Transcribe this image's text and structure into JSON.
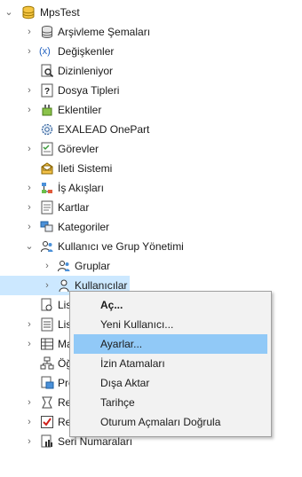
{
  "tree": {
    "items": [
      {
        "label": "MpsTest",
        "expander": "expanded",
        "icon": "database-icon"
      },
      {
        "label": "Arşivleme Şemaları",
        "expander": "collapsed",
        "icon": "archive-schema-icon"
      },
      {
        "label": "Değişkenler",
        "expander": "collapsed",
        "icon": "variable-icon",
        "icon_text": "(x)"
      },
      {
        "label": "Dizinleniyor",
        "expander": "none",
        "icon": "index-search-icon"
      },
      {
        "label": "Dosya Tipleri",
        "expander": "collapsed",
        "icon": "file-type-icon"
      },
      {
        "label": "Eklentiler",
        "expander": "collapsed",
        "icon": "plugin-icon"
      },
      {
        "label": "EXALEAD OnePart",
        "expander": "none",
        "icon": "gear-icon"
      },
      {
        "label": "Görevler",
        "expander": "collapsed",
        "icon": "task-list-icon"
      },
      {
        "label": "İleti Sistemi",
        "expander": "none",
        "icon": "mail-icon"
      },
      {
        "label": "İş Akışları",
        "expander": "collapsed",
        "icon": "workflow-icon"
      },
      {
        "label": "Kartlar",
        "expander": "collapsed",
        "icon": "card-icon"
      },
      {
        "label": "Kategoriler",
        "expander": "collapsed",
        "icon": "category-icon"
      },
      {
        "label": "Kullanıcı ve Grup Yönetimi",
        "expander": "expanded",
        "icon": "user-group-icon"
      },
      {
        "label": "Gruplar",
        "expander": "collapsed",
        "icon": "group-icon"
      },
      {
        "label": "Kullanıcılar",
        "expander": "collapsed",
        "icon": "user-icon"
      },
      {
        "label": "Lis",
        "expander": "none",
        "icon": "list-doc-icon"
      },
      {
        "label": "Lis",
        "expander": "collapsed",
        "icon": "list-icon"
      },
      {
        "label": "Ma",
        "expander": "collapsed",
        "icon": "table-icon"
      },
      {
        "label": "Öğ",
        "expander": "none",
        "icon": "tree-items-icon"
      },
      {
        "label": "Pro",
        "expander": "none",
        "icon": "doc-blue-icon"
      },
      {
        "label": "Re",
        "expander": "collapsed",
        "icon": "revision-icon"
      },
      {
        "label": "Re",
        "expander": "collapsed",
        "icon": "red-check-icon"
      },
      {
        "label": "Seri Numaraları",
        "expander": "collapsed",
        "icon": "serial-numbers-icon"
      }
    ]
  },
  "context_menu": {
    "items": [
      {
        "label": "Aç...",
        "bold": true,
        "highlighted": false
      },
      {
        "label": "Yeni Kullanıcı...",
        "bold": false,
        "highlighted": false
      },
      {
        "label": "Ayarlar...",
        "bold": false,
        "highlighted": true
      },
      {
        "label": "İzin Atamaları",
        "bold": false,
        "highlighted": false
      },
      {
        "label": "Dışa Aktar",
        "bold": false,
        "highlighted": false
      },
      {
        "label": "Tarihçe",
        "bold": false,
        "highlighted": false
      },
      {
        "label": "Oturum Açmaları Doğrula",
        "bold": false,
        "highlighted": false
      }
    ]
  },
  "colors": {
    "selection": "#cce8ff",
    "menu_highlight": "#91c9f7",
    "menu_background": "#f2f2f2"
  }
}
